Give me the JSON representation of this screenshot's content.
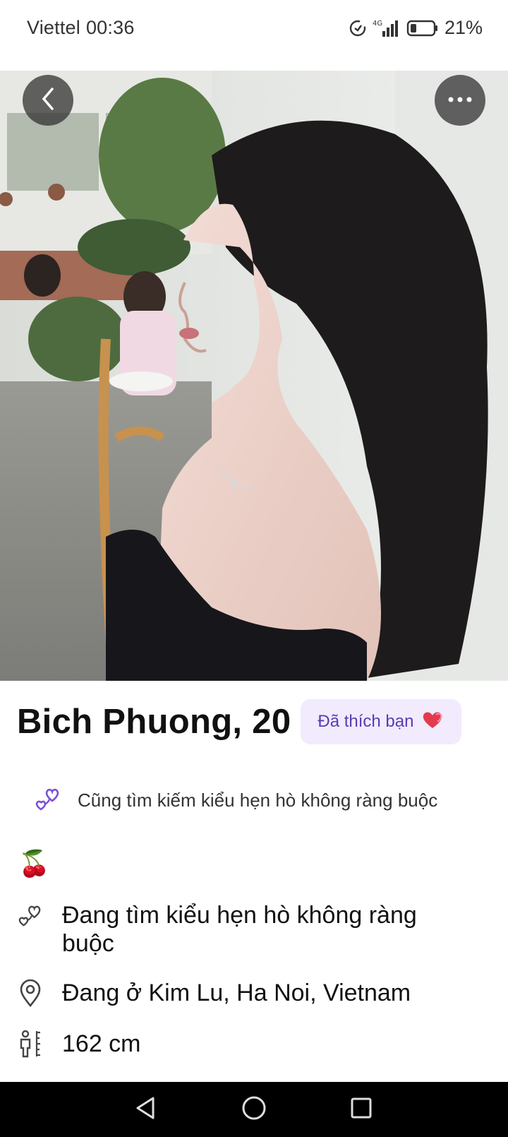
{
  "status_bar": {
    "carrier": "Viettel",
    "time": "00:36",
    "network": "4G",
    "battery_percent": "21%"
  },
  "photo": {
    "alt_subject": "profile-photo",
    "back_icon": "chevron-left-icon",
    "more_icon": "more-horizontal-icon"
  },
  "profile": {
    "name_age": "Bich Phuong, 20",
    "liked_badge": "Đã thích bạn",
    "match_note": "Cũng tìm kiếm kiểu hẹn hò không ràng buộc",
    "emoji": "🍒",
    "looking_for": "Đang tìm kiểu hẹn hò không ràng buộc",
    "location": "Đang ở Kim Lu, Ha Noi, Vietnam",
    "height": "162 cm"
  },
  "colors": {
    "badge_bg": "#f1ebfd",
    "badge_text": "#5b3bb3",
    "accent_purple": "#7b4fd6",
    "heart_red": "#e23b4f"
  },
  "nav": {
    "back_icon": "triangle-back-icon",
    "home_icon": "circle-home-icon",
    "recent_icon": "square-recent-icon"
  }
}
